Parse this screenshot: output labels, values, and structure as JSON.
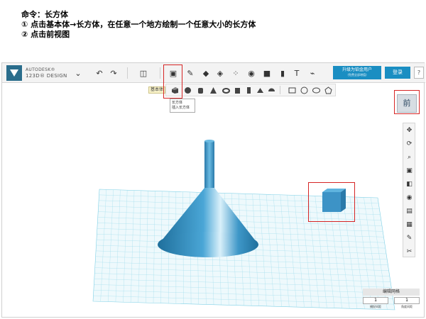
{
  "instructions": {
    "line1": "命令：长方体",
    "line2": "①  点击基本体→长方体，在任意一个地方绘制一个任意大小的长方体",
    "line3": "②  点击前视图"
  },
  "app": {
    "brand_line1": "AUTODESK®",
    "brand_line2": "123D® DESIGN",
    "upgrade_label": "升级为铂金用户",
    "upgrade_sub": "(免费全部增值)",
    "login_label": "登录",
    "help_label": "?"
  },
  "primitives": {
    "group_label": "基本体",
    "tooltip_title": "长方体",
    "tooltip_desc": "插入长方体"
  },
  "viewcube": {
    "label": "前"
  },
  "grid_edit": {
    "title": "编辑网格",
    "value1": "1",
    "value2": "1",
    "label1": "捕捉间距",
    "label2": "角度间距"
  },
  "colors": {
    "accent": "#1a8ec2",
    "highlight": "#d62525",
    "grid": "#7fd0e6",
    "model": "#4a9fd0"
  }
}
